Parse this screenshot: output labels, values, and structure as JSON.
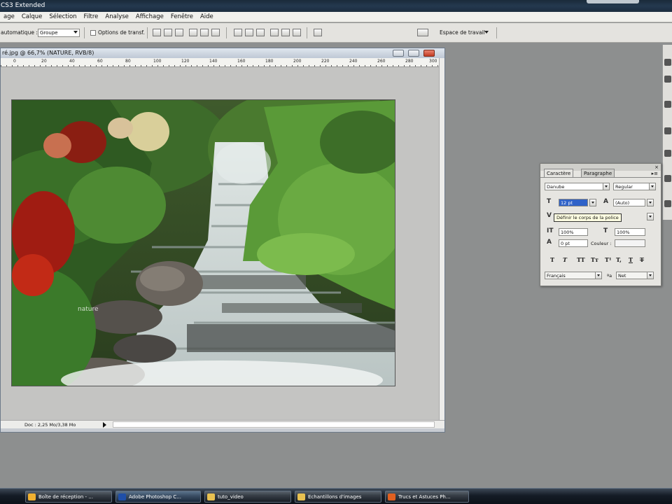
{
  "app": {
    "title": "CS3 Extended"
  },
  "menu": [
    "age",
    "Calque",
    "Sélection",
    "Filtre",
    "Analyse",
    "Affichage",
    "Fenêtre",
    "Aide"
  ],
  "options_bar": {
    "auto_select_label": "automatique :",
    "group_value": "Groupe",
    "transform_label": "Options de transf.",
    "workspace_label": "Espace de travail"
  },
  "document": {
    "title": "ré.jpg @ 66,7% (NATURE, RVB/8)",
    "ruler_ticks": [
      "0",
      "20",
      "40",
      "60",
      "80",
      "100",
      "120",
      "140",
      "160",
      "180",
      "200",
      "220",
      "240",
      "260",
      "280",
      "300"
    ],
    "status_text": "Doc : 2,25 Mo/3,38 Mo",
    "watermark": "nature"
  },
  "character_panel": {
    "tabs": [
      "Caractère",
      "Paragraphe"
    ],
    "font_family": "Danube",
    "font_style": "Regular",
    "font_size": "12 pt",
    "leading": "(Auto)",
    "vertical_scale": "100%",
    "horizontal_scale": "100%",
    "baseline_shift": "0 pt",
    "color_label": "Couleur :",
    "style_buttons": [
      "T",
      "T",
      "TT",
      "Tт",
      "T¹",
      "T,",
      "T",
      "T"
    ],
    "language": "Français",
    "antialias": "Net",
    "antialias_prefix": "ªa",
    "tooltip": "Définir le corps de la police"
  },
  "taskbar": {
    "items": [
      {
        "label": "Boîte de réception - ...",
        "color": "#f0b030"
      },
      {
        "label": "Adobe Photoshop C...",
        "color": "#1f4fa8"
      },
      {
        "label": "tuto_video",
        "color": "#e8c050"
      },
      {
        "label": "Echantillons d'images",
        "color": "#e8c050"
      },
      {
        "label": "Trucs et Astuces Ph...",
        "color": "#e06020"
      }
    ]
  },
  "colors": {
    "accent": "#2f62c8",
    "close_button": "#c23b22"
  }
}
